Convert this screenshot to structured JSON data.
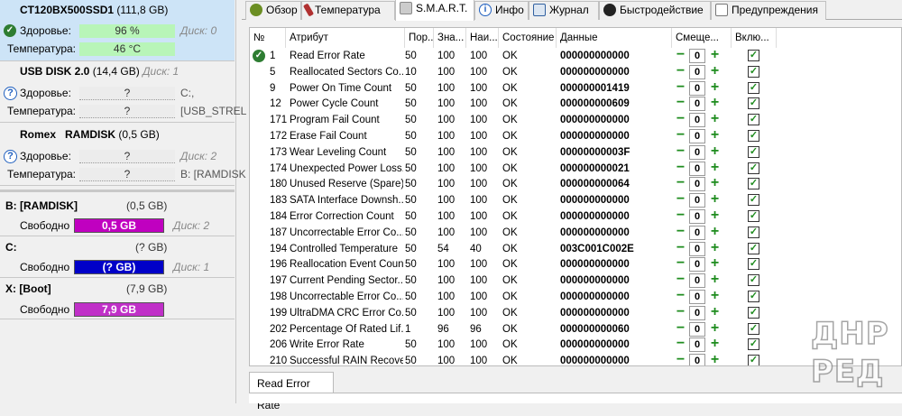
{
  "disks": [
    {
      "model_bold": "CT120BX500SSD1",
      "size": "(111,8 GB)",
      "health_label": "Здоровье:",
      "health": "96 %",
      "health_side": "Диск: 0",
      "temp_label": "Температура:",
      "temp": "46 °C",
      "temp_side": ""
    },
    {
      "model_bold": "USB DISK 2.0",
      "size": "(14,4 GB)",
      "side": "Диск: 1",
      "health_label": "Здоровье:",
      "health": "?",
      "health_side": "C:,",
      "temp_label": "Температура:",
      "temp": "?",
      "temp_side": "[USB_STREL"
    },
    {
      "model_bold": "Romex   RAMDISK",
      "size": "(0,5 GB)",
      "health_label": "Здоровье:",
      "health": "?",
      "health_side": "Диск: 2",
      "temp_label": "Температура:",
      "temp": "?",
      "temp_side": "B: [RAMDISK"
    }
  ],
  "volumes": [
    {
      "name": "B: [RAMDISK]",
      "size": "(0,5 GB)",
      "free_label": "Свободно",
      "free": "0,5 GB",
      "side": "Диск: 2",
      "color": "#c000c0"
    },
    {
      "name": "C:",
      "size": "(? GB)",
      "free_label": "Свободно",
      "free": "(? GB)",
      "side": "Диск: 1",
      "color": "#0000c8"
    },
    {
      "name": "X: [Boot]",
      "size": "(7,9 GB)",
      "free_label": "Свободно",
      "free": "7,9 GB",
      "side": "",
      "color": "#c030c8"
    }
  ],
  "tabs": [
    {
      "label": "Обзор",
      "icon": "overview-icon",
      "color": "#6b8e23"
    },
    {
      "label": "Температура",
      "icon": "thermometer-icon",
      "color": "#b03030"
    },
    {
      "label": "S.M.A.R.T.",
      "icon": "smart-icon",
      "color": "#888888"
    },
    {
      "label": "Инфо",
      "icon": "info-icon",
      "color": "#1f5fbf"
    },
    {
      "label": "Журнал",
      "icon": "journal-icon",
      "color": "#3060a0"
    },
    {
      "label": "Быстродействие",
      "icon": "speed-icon",
      "color": "#222222"
    },
    {
      "label": "Предупреждения",
      "icon": "warnings-icon",
      "color": "#777777"
    }
  ],
  "grid": {
    "headers": [
      "№",
      "Атрибут",
      "Пор...",
      "Зна...",
      "Наи...",
      "Состояние",
      "Данные",
      "Смеще...",
      "Вклю..."
    ],
    "rows": [
      {
        "n": "1",
        "attr": "Read Error Rate",
        "thr": "50",
        "val": "100",
        "worst": "100",
        "state": "OK",
        "data": "000000000000",
        "offset": "0"
      },
      {
        "n": "5",
        "attr": "Reallocated Sectors Co...",
        "thr": "10",
        "val": "100",
        "worst": "100",
        "state": "OK",
        "data": "000000000000",
        "offset": "0"
      },
      {
        "n": "9",
        "attr": "Power On Time Count",
        "thr": "50",
        "val": "100",
        "worst": "100",
        "state": "OK",
        "data": "000000001419",
        "offset": "0"
      },
      {
        "n": "12",
        "attr": "Power Cycle Count",
        "thr": "50",
        "val": "100",
        "worst": "100",
        "state": "OK",
        "data": "000000000609",
        "offset": "0"
      },
      {
        "n": "171",
        "attr": "Program Fail Count",
        "thr": "50",
        "val": "100",
        "worst": "100",
        "state": "OK",
        "data": "000000000000",
        "offset": "0"
      },
      {
        "n": "172",
        "attr": "Erase Fail Count",
        "thr": "50",
        "val": "100",
        "worst": "100",
        "state": "OK",
        "data": "000000000000",
        "offset": "0"
      },
      {
        "n": "173",
        "attr": "Wear Leveling Count",
        "thr": "50",
        "val": "100",
        "worst": "100",
        "state": "OK",
        "data": "00000000003F",
        "offset": "0"
      },
      {
        "n": "174",
        "attr": "Unexpected Power Loss...",
        "thr": "50",
        "val": "100",
        "worst": "100",
        "state": "OK",
        "data": "000000000021",
        "offset": "0"
      },
      {
        "n": "180",
        "attr": "Unused Reserve (Spare)...",
        "thr": "50",
        "val": "100",
        "worst": "100",
        "state": "OK",
        "data": "000000000064",
        "offset": "0"
      },
      {
        "n": "183",
        "attr": "SATA Interface Downsh...",
        "thr": "50",
        "val": "100",
        "worst": "100",
        "state": "OK",
        "data": "000000000000",
        "offset": "0"
      },
      {
        "n": "184",
        "attr": "Error Correction Count",
        "thr": "50",
        "val": "100",
        "worst": "100",
        "state": "OK",
        "data": "000000000000",
        "offset": "0"
      },
      {
        "n": "187",
        "attr": "Uncorrectable Error Co...",
        "thr": "50",
        "val": "100",
        "worst": "100",
        "state": "OK",
        "data": "000000000000",
        "offset": "0"
      },
      {
        "n": "194",
        "attr": "Controlled Temperature",
        "thr": "50",
        "val": "54",
        "worst": "40",
        "state": "OK",
        "data": "003C001C002E",
        "offset": "0"
      },
      {
        "n": "196",
        "attr": "Reallocation Event Count",
        "thr": "50",
        "val": "100",
        "worst": "100",
        "state": "OK",
        "data": "000000000000",
        "offset": "0"
      },
      {
        "n": "197",
        "attr": "Current Pending Sector...",
        "thr": "50",
        "val": "100",
        "worst": "100",
        "state": "OK",
        "data": "000000000000",
        "offset": "0"
      },
      {
        "n": "198",
        "attr": "Uncorrectable Error Co...",
        "thr": "50",
        "val": "100",
        "worst": "100",
        "state": "OK",
        "data": "000000000000",
        "offset": "0"
      },
      {
        "n": "199",
        "attr": "UltraDMA CRC Error Co...",
        "thr": "50",
        "val": "100",
        "worst": "100",
        "state": "OK",
        "data": "000000000000",
        "offset": "0"
      },
      {
        "n": "202",
        "attr": "Percentage Of Rated Lif...",
        "thr": "1",
        "val": "96",
        "worst": "96",
        "state": "OK",
        "data": "000000000060",
        "offset": "0"
      },
      {
        "n": "206",
        "attr": "Write Error Rate",
        "thr": "50",
        "val": "100",
        "worst": "100",
        "state": "OK",
        "data": "000000000000",
        "offset": "0"
      },
      {
        "n": "210",
        "attr": "Successful RAIN Recove...",
        "thr": "50",
        "val": "100",
        "worst": "100",
        "state": "OK",
        "data": "000000000000",
        "offset": "0"
      }
    ]
  },
  "bottom": {
    "tab_label": "Read Error Rate"
  },
  "watermark": {
    "line1": "ДНР",
    "line2": "РЕД"
  }
}
